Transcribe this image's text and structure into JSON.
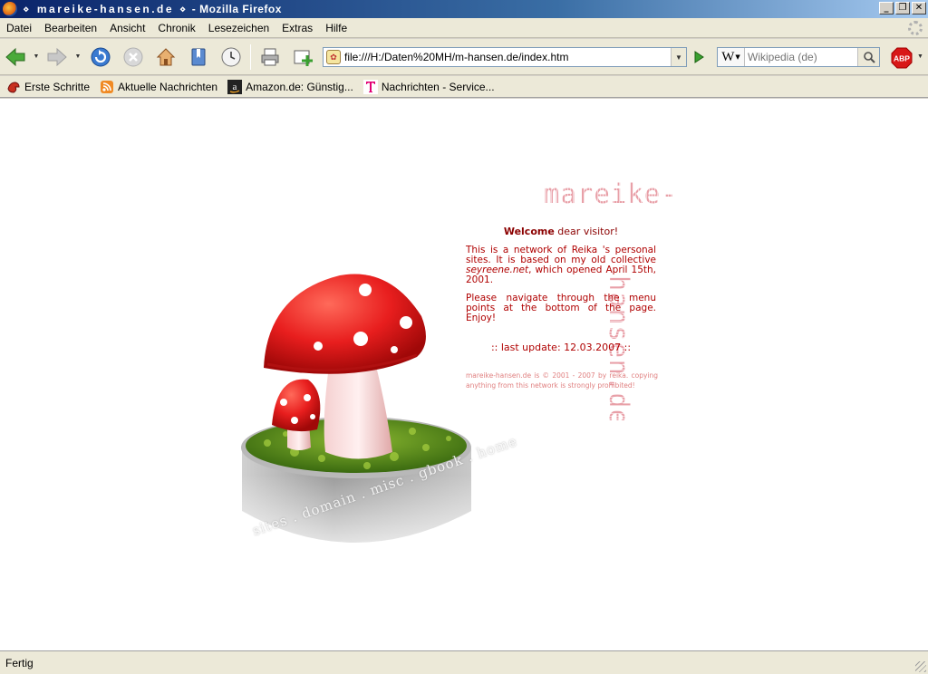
{
  "window": {
    "title_site": "⋄ mareike-hansen.de ⋄",
    "title_app": " - Mozilla Firefox",
    "buttons": {
      "minimize": "_",
      "restore": "❐",
      "close": "✕"
    }
  },
  "menu": {
    "items": [
      "Datei",
      "Bearbeiten",
      "Ansicht",
      "Chronik",
      "Lesezeichen",
      "Extras",
      "Hilfe"
    ]
  },
  "navigation": {
    "url": "file:///H:/Daten%20MH/m-hansen.de/index.htm",
    "search_placeholder": "Wikipedia (de)",
    "search_engine_glyph": "W",
    "adblock_label": "ABP",
    "icons": [
      "back-icon",
      "forward-icon",
      "reload-icon",
      "stop-icon",
      "home-icon",
      "bookmarks-icon",
      "history-icon",
      "print-icon",
      "new-tab-icon",
      "go-icon",
      "search-icon"
    ]
  },
  "bookmarks": [
    {
      "label": "Erste Schritte",
      "icon": "firefox-bookmark-icon"
    },
    {
      "label": "Aktuelle Nachrichten",
      "icon": "rss-feed-icon"
    },
    {
      "label": "Amazon.de: Günstig...",
      "icon": "amazon-icon"
    },
    {
      "label": "Nachrichten - Service...",
      "icon": "telekom-icon"
    }
  ],
  "page": {
    "site_title_horizontal": "mareike-",
    "site_title_vertical": "hansen.de",
    "welcome_bold": "Welcome",
    "welcome_rest": " dear visitor!",
    "intro_before": "This is a network of Reika 's personal sites. It is based on my old collective ",
    "intro_link": "seyreene.net",
    "intro_after": ", which opened April 15th, 2001.",
    "navigate": "Please navigate through the menu points at the bottom of the page. Enjoy!",
    "last_update": ":: last update: 12.03.2007 ::",
    "copyright": "mareike-hansen.de is © 2001 - 2007 by reika. copying anything from this network is strongly prohibited!",
    "menu_points": [
      "sites",
      "domain",
      "misc",
      "gbook",
      "home"
    ],
    "menu_separator": " . "
  },
  "status": {
    "text": "Fertig"
  },
  "colors": {
    "accent_red": "#b00000",
    "title_pink": "#e8a0a8"
  }
}
